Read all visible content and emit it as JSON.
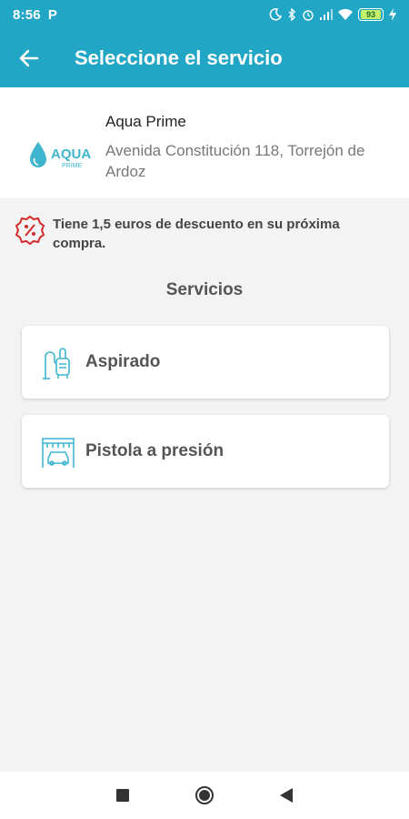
{
  "status_bar": {
    "time": "8:56",
    "app_letter": "P",
    "battery": "93"
  },
  "app_bar": {
    "back_icon": "arrow-back-icon",
    "title": "Seleccione el servicio"
  },
  "station": {
    "logo_text": "AQUA",
    "logo_subtext": "PRIME",
    "name": "Aqua Prime",
    "address": "Avenida Constitución 118, Torrejón de Ardoz"
  },
  "discount": {
    "icon": "percent-badge-icon",
    "text": "Tiene 1,5 euros de descuento en su próxima compra."
  },
  "services": {
    "title": "Servicios",
    "items": [
      {
        "label": "Aspirado",
        "icon": "vacuum-icon"
      },
      {
        "label": "Pistola a presión",
        "icon": "car-wash-icon"
      }
    ]
  },
  "colors": {
    "primary": "#22a6c6",
    "accent_icon": "#3fb5cf",
    "discount_red": "#d42a2a"
  }
}
